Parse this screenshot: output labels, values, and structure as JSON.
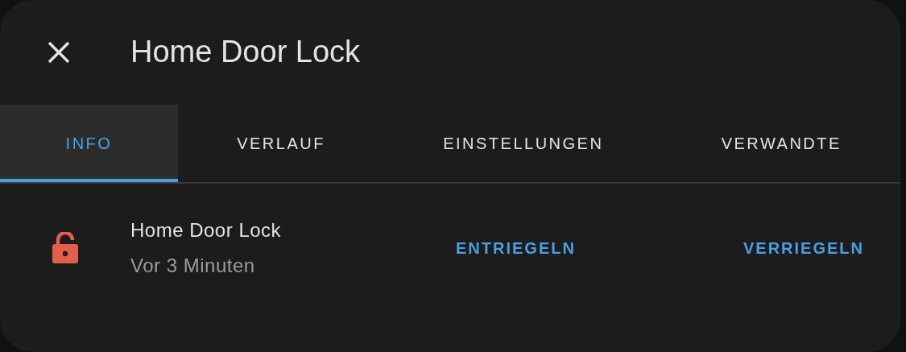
{
  "dialog": {
    "title": "Home Door Lock"
  },
  "tabs": [
    {
      "label": "INFO",
      "selected": true
    },
    {
      "label": "VERLAUF",
      "selected": false
    },
    {
      "label": "EINSTELLUNGEN",
      "selected": false
    },
    {
      "label": "VERWANDTE",
      "selected": false
    }
  ],
  "entity": {
    "name": "Home Door Lock",
    "last_changed": "Vor 3 Minuten",
    "locked": false
  },
  "actions": [
    "ENTRIEGELN",
    "VERRIEGELN"
  ]
}
